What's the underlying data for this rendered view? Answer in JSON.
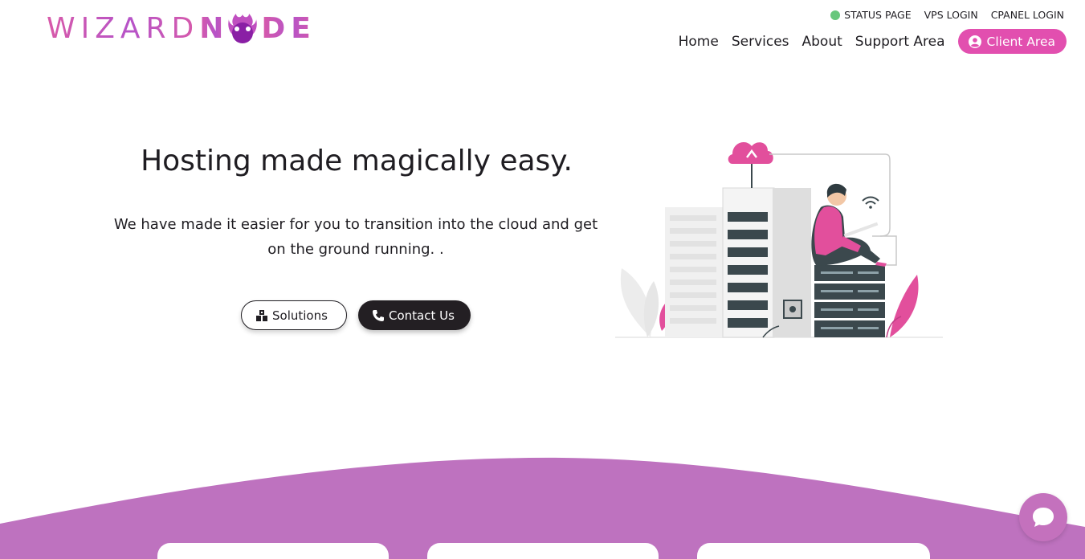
{
  "brand": {
    "logo_part1": "WIZARD",
    "logo_part2": "N",
    "logo_part3": "DE"
  },
  "topbar": {
    "status_page": "STATUS PAGE",
    "vps_login": "VPS LOGIN",
    "cpanel_login": "CPANEL LOGIN"
  },
  "nav": {
    "items": [
      "Home",
      "Services",
      "About",
      "Support Area"
    ],
    "client_area": "Client Area"
  },
  "hero": {
    "title": "Hosting made magically easy.",
    "subtitle_line1": "We have made it easier for you to transition into the cloud and get",
    "subtitle_line2": "on the ground running. .",
    "solutions_label": "Solutions",
    "contact_label": "Contact Us"
  },
  "colors": {
    "brand_pink": "#e24faf",
    "brand_purple": "#be72bf",
    "status_green": "#67c77c",
    "dark": "#231f23"
  },
  "icons": {
    "status": "status-dot-icon",
    "client": "user-circle-icon",
    "solutions": "cubes-icon",
    "contact": "phone-icon",
    "chat": "chat-bubble-icon"
  }
}
